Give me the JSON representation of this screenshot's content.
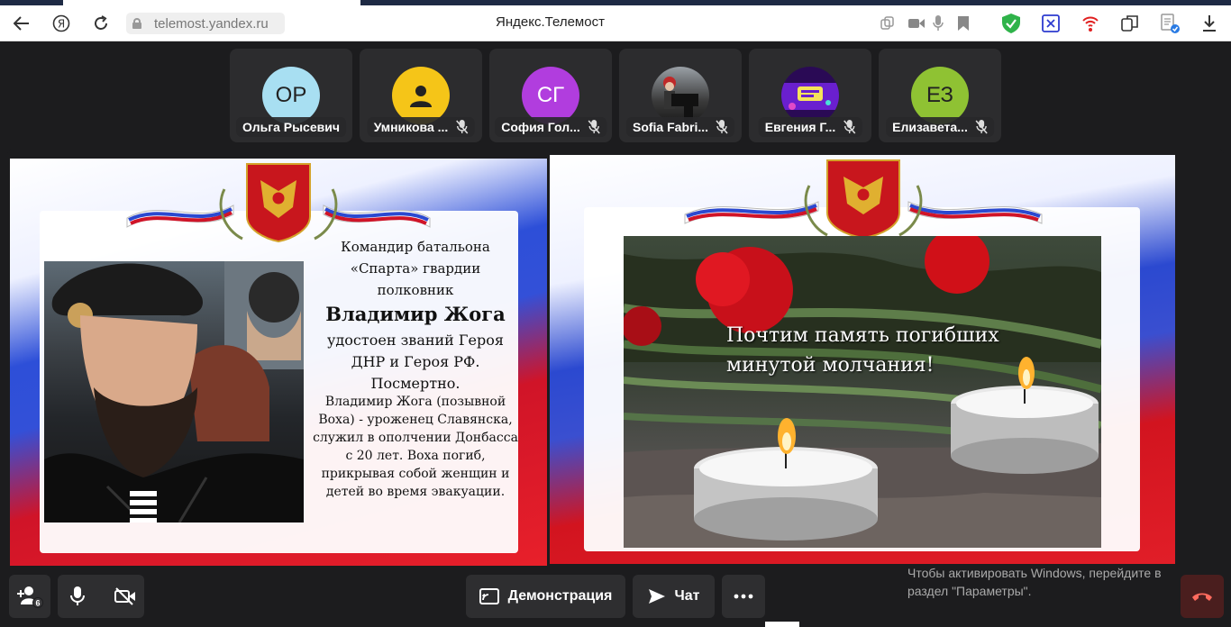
{
  "browser": {
    "url": "telemost.yandex.ru",
    "page_title": "Яндекс.Телемост"
  },
  "participants": [
    {
      "initials": "ОР",
      "name": "Ольга Рысевич",
      "color": "#a8dff2",
      "muted": false
    },
    {
      "initials": "",
      "name": "Умникова ...",
      "color": "#f5c518",
      "muted": true
    },
    {
      "initials": "СГ",
      "name": "София Гол...",
      "color": "#b13dde",
      "muted": true
    },
    {
      "initials": "",
      "name": "Sofia Fabri...",
      "color": "#555555",
      "muted": true
    },
    {
      "initials": "",
      "name": "Евгения Г...",
      "color": "#2a0a55",
      "muted": true
    },
    {
      "initials": "ЕЗ",
      "name": "Елизавета...",
      "color": "#8fc233",
      "muted": true
    }
  ],
  "slide_left": {
    "line1": "Командир батальона «Спарта» гвардии полковник",
    "name": "Владимир Жога",
    "line3": "удостоен званий Героя ДНР и Героя РФ. Посмертно.",
    "line4": "Владимир Жога (позывной Воха) - уроженец Славянска, служил в ополчении Донбасса с 20 лет. Воха погиб, прикрывая собой женщин и детей во время эвакуации."
  },
  "slide_right": {
    "memorial_line1": "Почтим память погибших",
    "memorial_line2": "минутой молчания!"
  },
  "toolbar": {
    "invite_badge": "6",
    "demo_label": "Демонстрация",
    "chat_label": "Чат"
  },
  "windows_activation": {
    "line1": "Чтобы активировать Windows, перейдите в",
    "line2": "раздел \"Параметры\"."
  }
}
